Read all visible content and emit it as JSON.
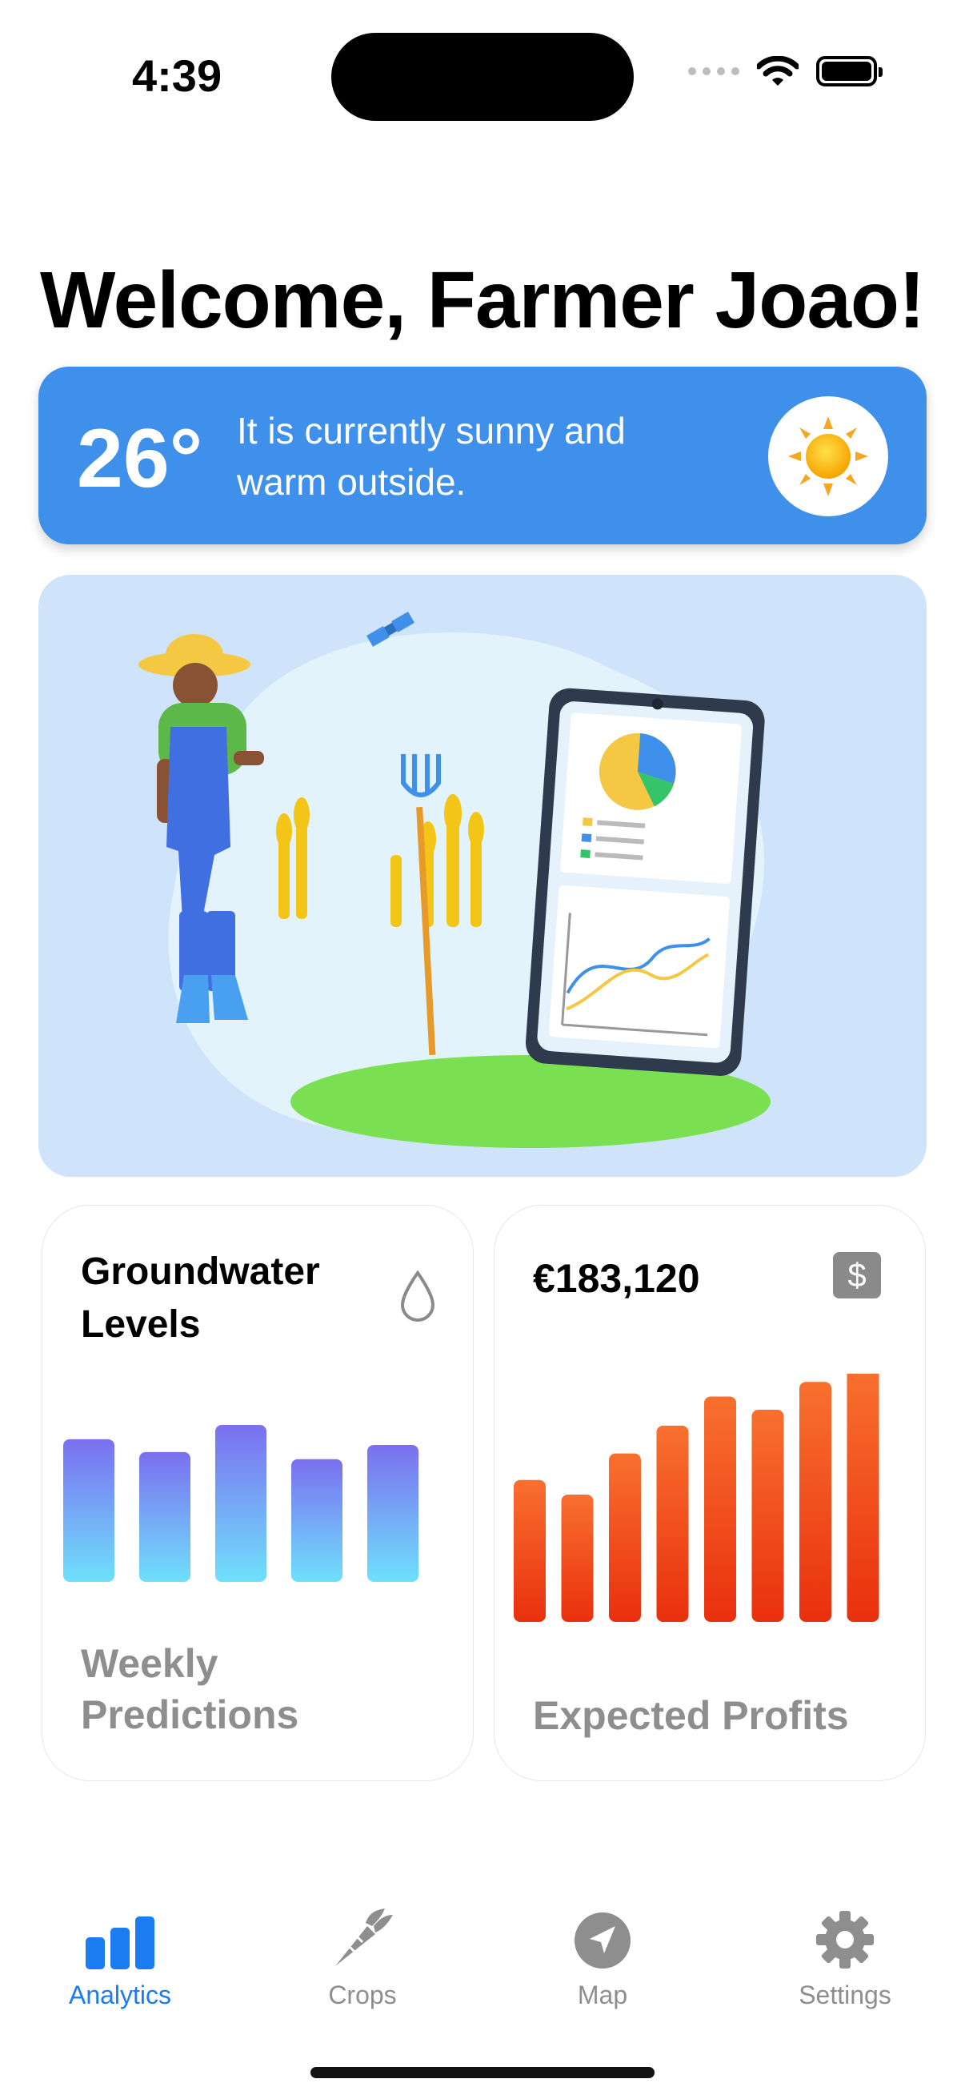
{
  "status_bar": {
    "time": "4:39"
  },
  "header": {
    "title": "Welcome, Farmer Joao!"
  },
  "weather": {
    "temperature": "26°",
    "description": "It is currently sunny and warm outside.",
    "icon": "sun-icon",
    "background_color": "#3f90ea"
  },
  "hero": {
    "illustration": "farmer-with-analytics-phone-illustration"
  },
  "groundwater_card": {
    "title": "Groundwater Levels",
    "icon": "water-drop-icon",
    "caption": "Weekly Predictions",
    "chart_data": {
      "type": "bar",
      "values": [
        10.0,
        9.1,
        11.0,
        8.6,
        9.6
      ],
      "gradient": [
        "#7b6ff0",
        "#6fe0fb"
      ]
    }
  },
  "profits_card": {
    "value": "€183,120",
    "icon": "dollar-icon",
    "icon_text": "$",
    "caption": "Expected Profits",
    "chart_data": {
      "type": "bar",
      "values": [
        10.7,
        9.6,
        12.7,
        14.8,
        17.0,
        16.0,
        18.1,
        19.2
      ],
      "gradient": [
        "#f8702e",
        "#e9300e"
      ]
    }
  },
  "tab_bar": {
    "active_color": "#1a7cf0",
    "inactive_color": "#8e8e8e",
    "tabs": [
      {
        "label": "Analytics",
        "icon": "bar-chart-icon",
        "active": true
      },
      {
        "label": "Crops",
        "icon": "carrot-icon",
        "active": false
      },
      {
        "label": "Map",
        "icon": "location-arrow-icon",
        "active": false
      },
      {
        "label": "Settings",
        "icon": "gear-icon",
        "active": false
      }
    ]
  }
}
